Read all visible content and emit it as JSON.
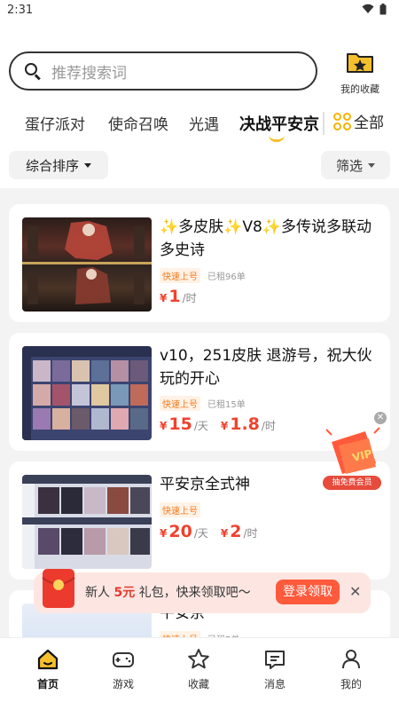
{
  "status": {
    "time": "2:31"
  },
  "search": {
    "placeholder": "推荐搜索词"
  },
  "favorites": {
    "label": "我的收藏"
  },
  "tabs": [
    "蛋仔派对",
    "使命召唤",
    "光遇",
    "决战平安京"
  ],
  "active_tab": "决战平安京",
  "all_label": "全部",
  "filters": {
    "sort_label": "综合排序",
    "filter_label": "筛选"
  },
  "listings": [
    {
      "title": "✨多皮肤✨V8✨多传说多联动多史诗",
      "badge": "快速上号",
      "rented": "已租96单",
      "prices": [
        {
          "amount": "1",
          "unit": "/时"
        }
      ]
    },
    {
      "title": "v10，251皮肤 退游号，祝大伙玩的开心",
      "badge": "快速上号",
      "rented": "已租15单",
      "prices": [
        {
          "amount": "15",
          "unit": "/天"
        },
        {
          "amount": "1.8",
          "unit": "/时"
        }
      ]
    },
    {
      "title": "平安京全式神",
      "badge": "快速上号",
      "rented": "",
      "prices": [
        {
          "amount": "20",
          "unit": "/天"
        },
        {
          "amount": "2",
          "unit": "/时"
        }
      ]
    },
    {
      "title": "平安京",
      "badge": "快速上号",
      "rented": "已租5单",
      "prices": []
    }
  ],
  "currency": "¥",
  "vip_float": {
    "tag": "抽免费会员"
  },
  "promo": {
    "prefix": "新人 ",
    "amount": "5元",
    "suffix": " 礼包，快来领取吧〜",
    "button": "登录领取"
  },
  "nav": [
    "首页",
    "游戏",
    "收藏",
    "消息",
    "我的"
  ],
  "colors": {
    "accent": "#f6c02c",
    "price": "#f0422e",
    "badge": "#f47a1c"
  }
}
